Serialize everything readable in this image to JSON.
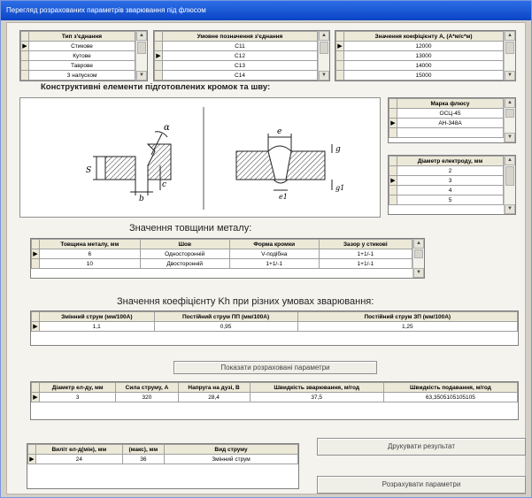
{
  "window": {
    "title": "Перегляд розрахованих параметрів зварювання під флюсом"
  },
  "joint_type": {
    "header": "Тип з'єднання",
    "rows": [
      "Стикове",
      "Кутове",
      "Таврове",
      "З напуском"
    ],
    "selected": 0
  },
  "symbol": {
    "header": "Умовне позначення з'єднання",
    "rows": [
      "С11",
      "С12",
      "С13",
      "С14"
    ],
    "selected": 1
  },
  "coef_a": {
    "header": "Значення коефіцієнту А, (А*м/с*м)",
    "rows": [
      "12000",
      "13000",
      "14000",
      "15000"
    ],
    "selected": 0
  },
  "flux": {
    "header": "Марка флюсу",
    "rows": [
      "ОСЦ-45",
      "АН-348А",
      ""
    ],
    "selected": 1
  },
  "electrode": {
    "header": "Діаметр електроду, мм",
    "rows": [
      "2",
      "3",
      "4",
      "5"
    ],
    "selected": 1
  },
  "constructive": {
    "title": "Конструктивні елементи підготовлених кромок та шву:",
    "marks_left": [
      "α",
      "S",
      "b",
      "c"
    ],
    "marks_right": [
      "e",
      "g",
      "e1",
      "g1"
    ]
  },
  "thickness": {
    "title": "Значення товщини металу:",
    "headers": [
      "Товщина металу, мм",
      "Шов",
      "Форма кромки",
      "Зазор у стикові"
    ],
    "rows": [
      [
        "6",
        "Односторонній",
        "V-подібна",
        "1+1/-1"
      ],
      [
        "10",
        "Двосторонній",
        "1+1/-1",
        "1+1/-1"
      ]
    ]
  },
  "kh": {
    "title": "Значення коефіцієнту Kh при різних умовах зварювання:",
    "headers": [
      "Змінний струм (мм/100А)",
      "Постійний струм ПП (мм/100А)",
      "Постійний струм ЗП (мм/100А)"
    ],
    "row": [
      "1,1",
      "0,95",
      "1,25"
    ]
  },
  "show_params_button": "Показати розраховані параметри",
  "results": {
    "headers": [
      "Діаметр ел-ду, мм",
      "Сила струму, А",
      "Напруга на дузі, В",
      "Швидкість зварювання, м/год",
      "Швидкість подавання, м/год"
    ],
    "row": [
      "3",
      "320",
      "28,4",
      "37,5",
      "63,3505105105105"
    ]
  },
  "extra": {
    "headers": [
      "Виліт ел-д(мін), мм",
      "(макс), мм",
      "Вид струму"
    ],
    "row": [
      "24",
      "36",
      "Змінний струм"
    ]
  },
  "print_button": "Друкувати результат",
  "calc_button": "Розрахувати параметри"
}
